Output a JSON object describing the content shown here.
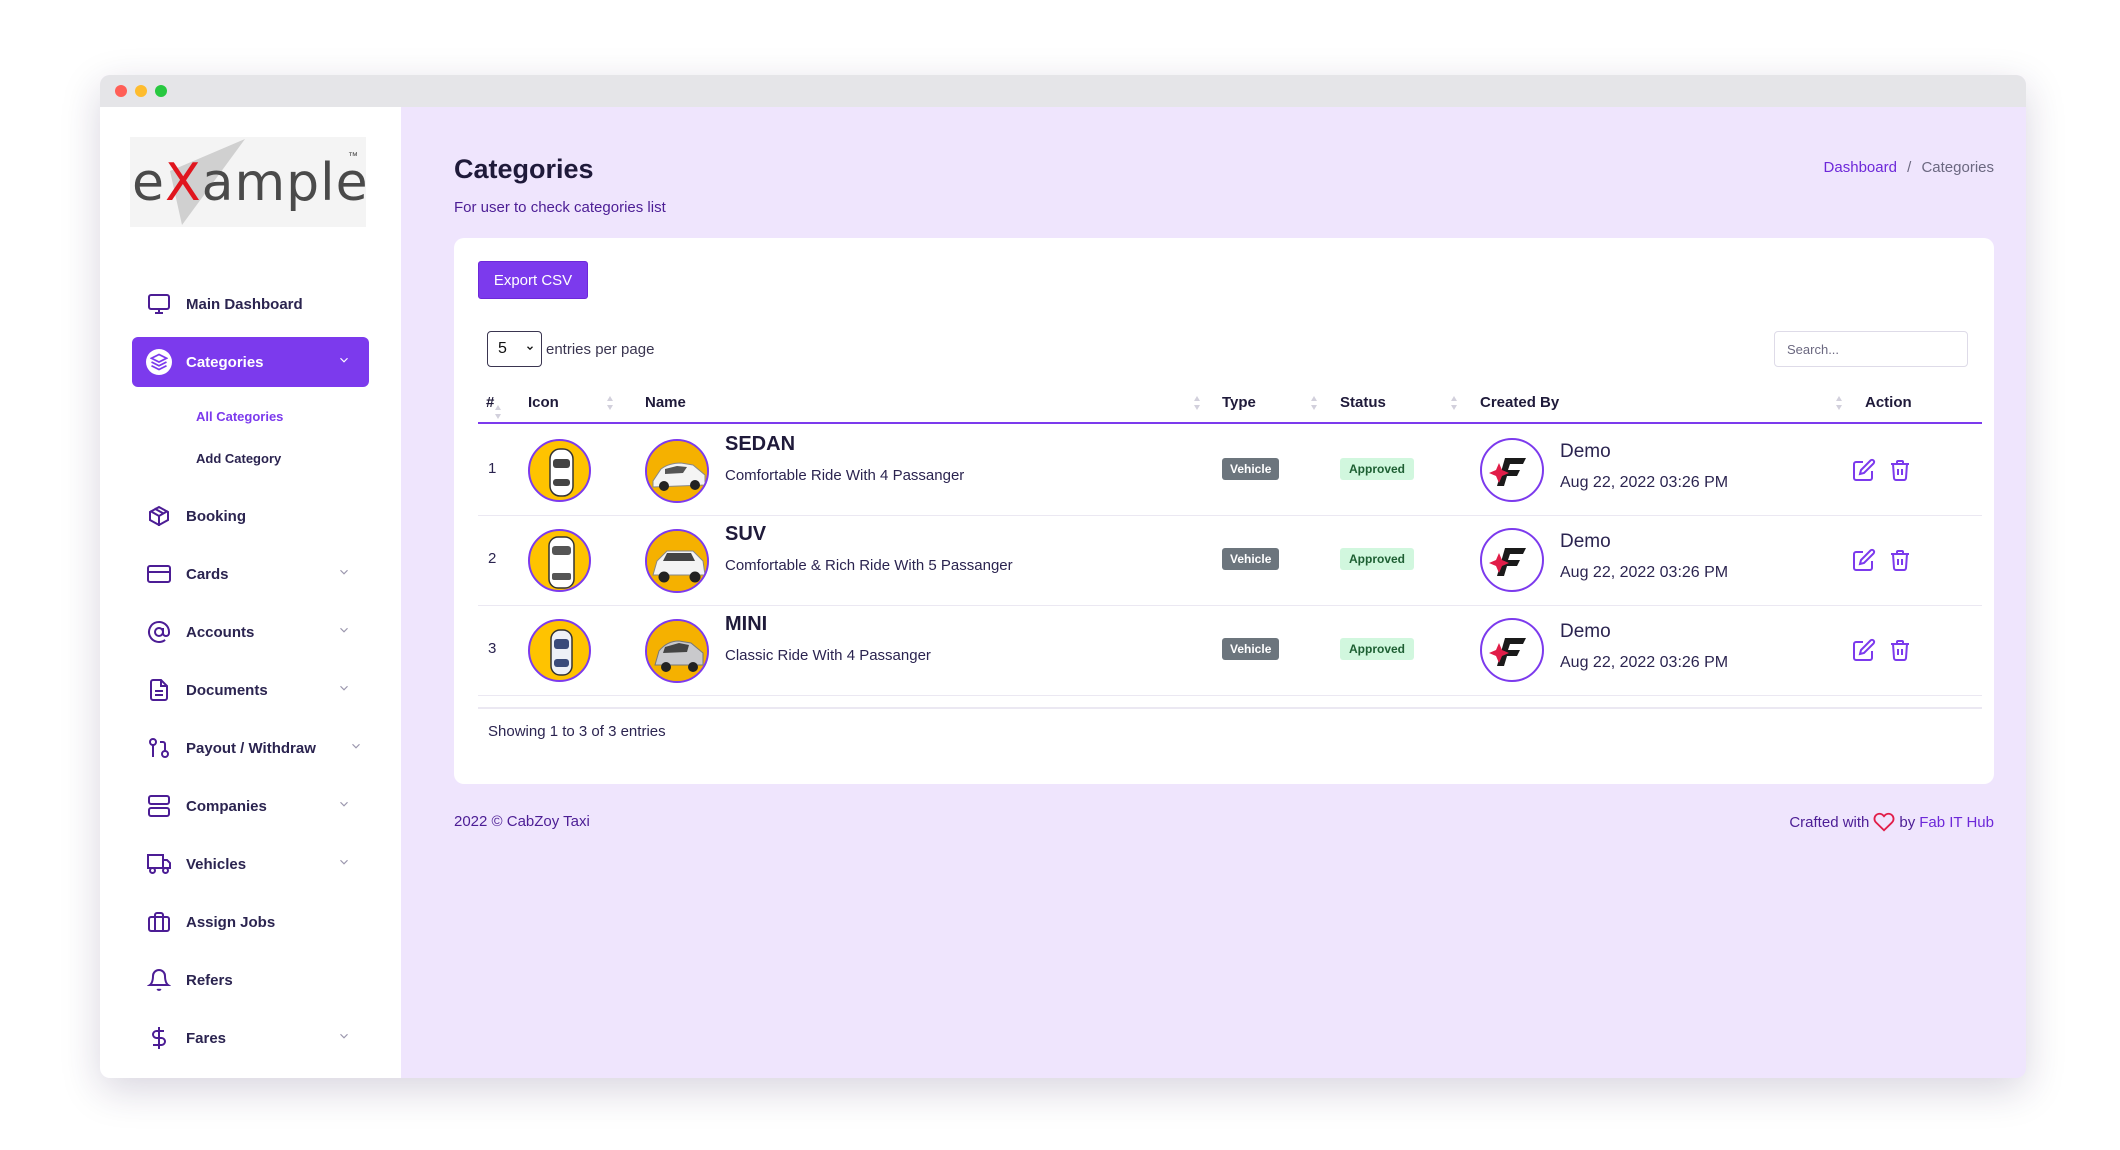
{
  "window": {
    "controls": [
      "close",
      "minimize",
      "maximize"
    ],
    "colors": [
      "#ff5f57",
      "#febc2e",
      "#28c840"
    ]
  },
  "logo": {
    "text_before": "e",
    "text_x": "X",
    "text_after": "ample",
    "tm": "™"
  },
  "sidebar": {
    "items": [
      {
        "label": "Main Dashboard",
        "icon": "monitor-icon",
        "has_chevron": false
      },
      {
        "label": "Categories",
        "icon": "layers-icon",
        "has_chevron": true,
        "active": true
      },
      {
        "label": "Booking",
        "icon": "box-icon",
        "has_chevron": false
      },
      {
        "label": "Cards",
        "icon": "credit-card-icon",
        "has_chevron": true
      },
      {
        "label": "Accounts",
        "icon": "at-sign-icon",
        "has_chevron": true
      },
      {
        "label": "Documents",
        "icon": "file-icon",
        "has_chevron": true
      },
      {
        "label": "Payout / Withdraw",
        "icon": "git-pull-icon",
        "has_chevron": true
      },
      {
        "label": "Companies",
        "icon": "server-icon",
        "has_chevron": true
      },
      {
        "label": "Vehicles",
        "icon": "truck-icon",
        "has_chevron": true
      },
      {
        "label": "Assign Jobs",
        "icon": "briefcase-icon",
        "has_chevron": false
      },
      {
        "label": "Refers",
        "icon": "bell-icon",
        "has_chevron": false
      },
      {
        "label": "Fares",
        "icon": "dollar-icon",
        "has_chevron": true
      }
    ],
    "subitems": [
      {
        "label": "All Categories",
        "active": true
      },
      {
        "label": "Add Category",
        "active": false
      }
    ]
  },
  "header": {
    "title": "Categories",
    "subtitle": "For user to check categories list",
    "breadcrumb_home": "Dashboard",
    "breadcrumb_sep": "/",
    "breadcrumb_current": "Categories"
  },
  "toolbar": {
    "export_label": "Export CSV",
    "entries_value": "5",
    "entries_label": "entries per page",
    "search_placeholder": "Search..."
  },
  "table": {
    "columns": [
      "#",
      "Icon",
      "Name",
      "Type",
      "Status",
      "Created By",
      "Action"
    ],
    "rows": [
      {
        "num": "1",
        "name": "SEDAN",
        "desc": "Comfortable Ride With 4 Passanger",
        "type": "Vehicle",
        "status": "Approved",
        "creator": "Demo",
        "date": "Aug 22, 2022 03:26 PM"
      },
      {
        "num": "2",
        "name": "SUV",
        "desc": "Comfortable & Rich Ride With 5 Passanger",
        "type": "Vehicle",
        "status": "Approved",
        "creator": "Demo",
        "date": "Aug 22, 2022 03:26 PM"
      },
      {
        "num": "3",
        "name": "MINI",
        "desc": "Classic Ride With 4 Passanger",
        "type": "Vehicle",
        "status": "Approved",
        "creator": "Demo",
        "date": "Aug 22, 2022 03:26 PM"
      }
    ],
    "showing": "Showing 1 to 3 of 3 entries"
  },
  "footer": {
    "copyright": "2022 © CabZoy Taxi",
    "crafted": "Crafted with",
    "by": "by",
    "brand": "Fab IT Hub"
  },
  "colors": {
    "accent": "#7c3aed",
    "background": "#efe5fd",
    "badge_type": "#6c757d",
    "badge_status": "#d1f7de",
    "heart": "#e11d48"
  }
}
